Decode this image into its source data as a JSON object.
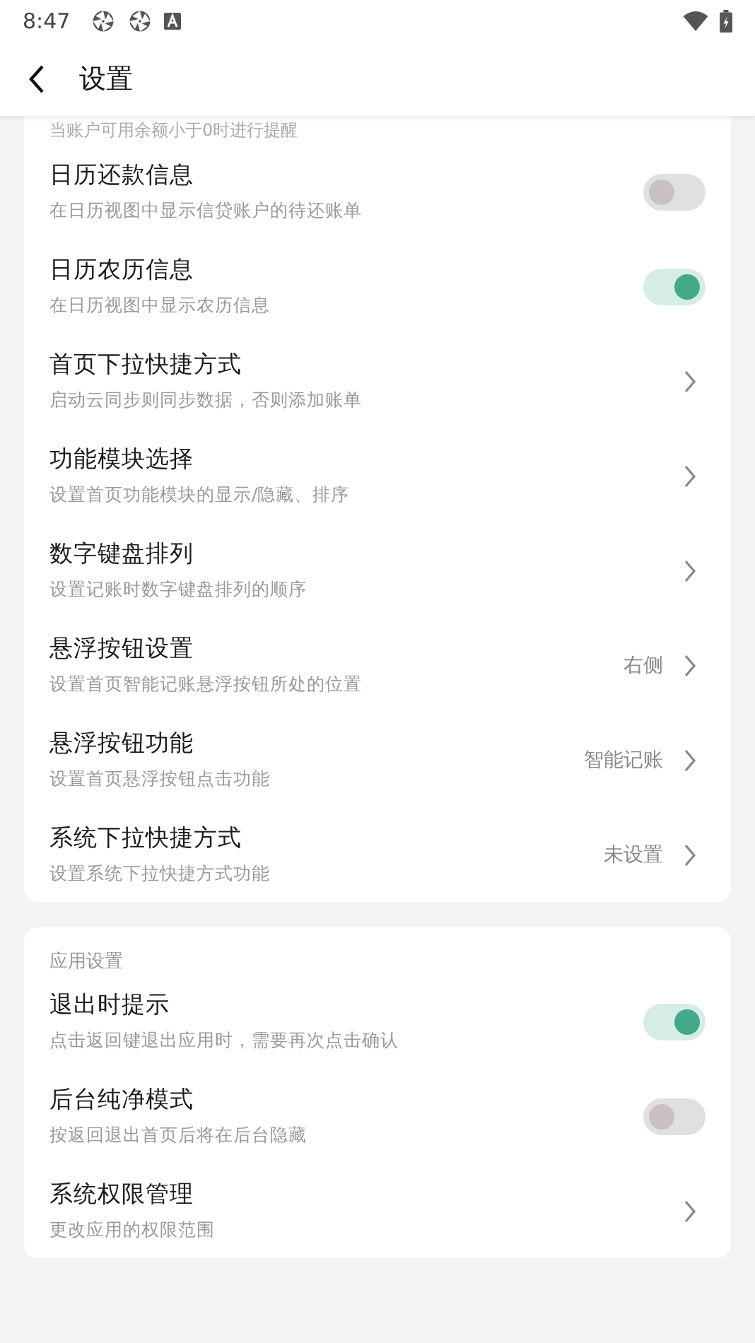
{
  "status_bar": {
    "time": "8:47"
  },
  "header": {
    "title": "设置"
  },
  "cut_off_note": "当账户可用余额小于0时进行提醒",
  "sections": [
    {
      "items": [
        {
          "kind": "toggle",
          "title": "日历还款信息",
          "subtitle": "在日历视图中显示信贷账户的待还账单",
          "on": false
        },
        {
          "kind": "toggle",
          "title": "日历农历信息",
          "subtitle": "在日历视图中显示农历信息",
          "on": true
        },
        {
          "kind": "link",
          "title": "首页下拉快捷方式",
          "subtitle": "启动云同步则同步数据，否则添加账单"
        },
        {
          "kind": "link",
          "title": "功能模块选择",
          "subtitle": "设置首页功能模块的显示/隐藏、排序"
        },
        {
          "kind": "link",
          "title": "数字键盘排列",
          "subtitle": "设置记账时数字键盘排列的顺序"
        },
        {
          "kind": "link",
          "title": "悬浮按钮设置",
          "subtitle": "设置首页智能记账悬浮按钮所处的位置",
          "value": "右侧"
        },
        {
          "kind": "link",
          "title": "悬浮按钮功能",
          "subtitle": "设置首页悬浮按钮点击功能",
          "value": "智能记账"
        },
        {
          "kind": "link",
          "title": "系统下拉快捷方式",
          "subtitle": "设置系统下拉快捷方式功能",
          "value": "未设置"
        }
      ]
    },
    {
      "heading": "应用设置",
      "items": [
        {
          "kind": "toggle",
          "title": "退出时提示",
          "subtitle": "点击返回键退出应用时，需要再次点击确认",
          "on": true
        },
        {
          "kind": "toggle",
          "title": "后台纯净模式",
          "subtitle": "按返回退出首页后将在后台隐藏",
          "on": false
        },
        {
          "kind": "link",
          "title": "系统权限管理",
          "subtitle": "更改应用的权限范围"
        }
      ]
    }
  ]
}
